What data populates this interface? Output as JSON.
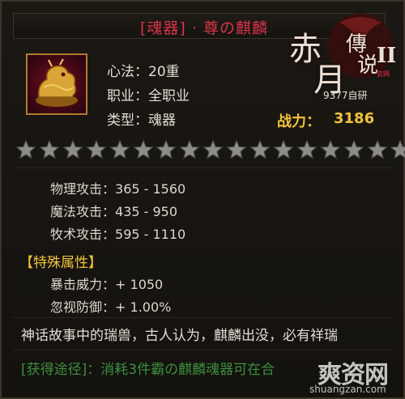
{
  "title": "[魂器] · 尊の麒麟",
  "logo": {
    "chars": [
      "赤",
      "月",
      "傳",
      "说",
      "II"
    ],
    "badge": "官网",
    "subtitle": "9377自研"
  },
  "info": {
    "xinfa": "心法：20重",
    "job": "职业：全职业",
    "type": "类型：魂器"
  },
  "power": {
    "label": "战力：",
    "value": "3186"
  },
  "stars": {
    "total": 17,
    "filled": 0
  },
  "stats": [
    {
      "label": "物理攻击：",
      "value": "365 - 1560"
    },
    {
      "label": "魔法攻击：",
      "value": "435 - 950"
    },
    {
      "label": "牧术攻击：",
      "value": "595 - 1110"
    }
  ],
  "special": {
    "title": "【特殊属性】",
    "items": [
      {
        "label": "暴击威力：",
        "value": "+ 1050"
      },
      {
        "label": "忽视防御：",
        "value": "+ 1.00%"
      }
    ]
  },
  "description": "神话故事中的瑞兽，古人认为，麒麟出没，必有祥瑞",
  "obtain": "[获得途径]：消耗3件霸の麒麟魂器可在合",
  "watermark": {
    "main": "爽资网",
    "url": "shuangzan.com"
  },
  "colors": {
    "title": "#d8344a",
    "power": "#f2c23b",
    "special_title": "#f2c23b",
    "obtain": "#3c8f3c",
    "text": "#e2ddd3",
    "icon_border": "#b07b2c"
  }
}
